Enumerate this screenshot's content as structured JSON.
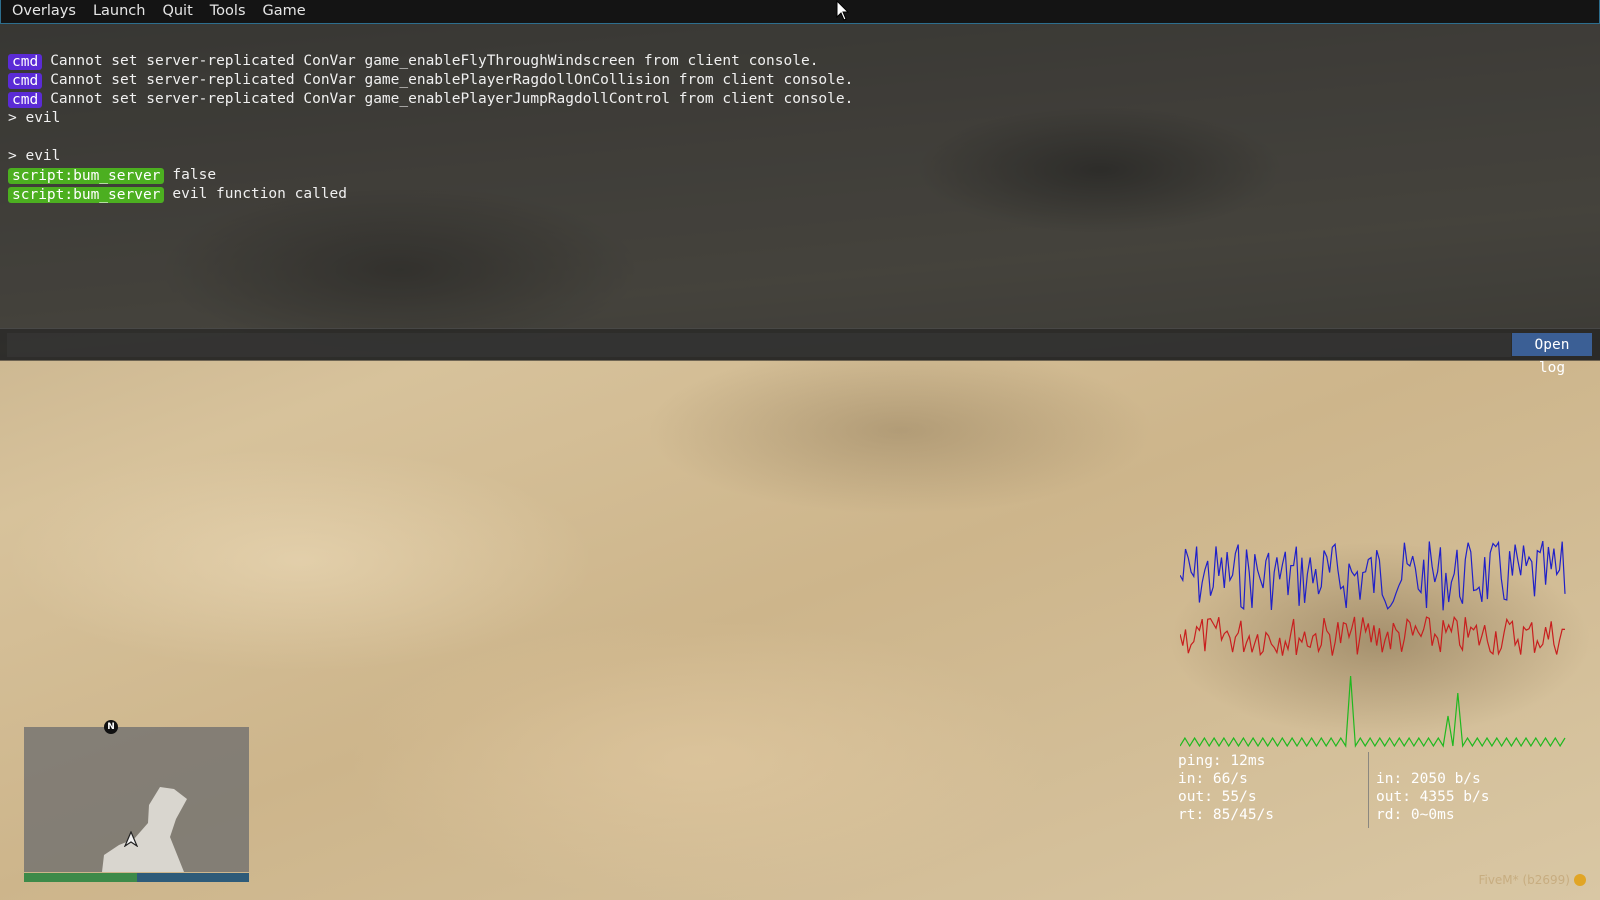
{
  "menubar": {
    "items": [
      "Overlays",
      "Launch",
      "Quit",
      "Tools",
      "Game"
    ]
  },
  "console": {
    "lines": [
      {
        "tag": "cmd",
        "text": "Cannot set server-replicated ConVar game_enableFlyThroughWindscreen from client console."
      },
      {
        "tag": "cmd",
        "text": "Cannot set server-replicated ConVar game_enablePlayerRagdollOnCollision from client console."
      },
      {
        "tag": "cmd",
        "text": "Cannot set server-replicated ConVar game_enablePlayerJumpRagdollControl from client console."
      },
      {
        "tag": "",
        "text": "> evil"
      },
      {
        "tag": "",
        "text": ""
      },
      {
        "tag": "",
        "text": "> evil"
      },
      {
        "tag": "script:bum_server",
        "text": "false"
      },
      {
        "tag": "script:bum_server",
        "text": "evil function called"
      }
    ],
    "input_value": "",
    "open_log_label": "Open log"
  },
  "netstats": {
    "ping": "ping: 12ms",
    "in_rate": "in: 66/s",
    "out_rate": "out: 55/s",
    "rt": "rt: 85/45/s",
    "in_bytes": "in: 2050 b/s",
    "out_bytes": "out: 4355 b/s",
    "rd": "rd: 0~0ms"
  },
  "minimap": {
    "north_label": "N",
    "health_fraction": 0.5,
    "armor_fraction": 0.5
  },
  "brand": "FiveM* (b2699)",
  "colors": {
    "cmd_tag": "#5b2bd6",
    "script_tag": "#4caf20",
    "open_log_button": "#3b5f95",
    "graph_in": "#2020c8",
    "graph_out": "#c81e1e",
    "graph_spikes": "#1fb81f"
  }
}
